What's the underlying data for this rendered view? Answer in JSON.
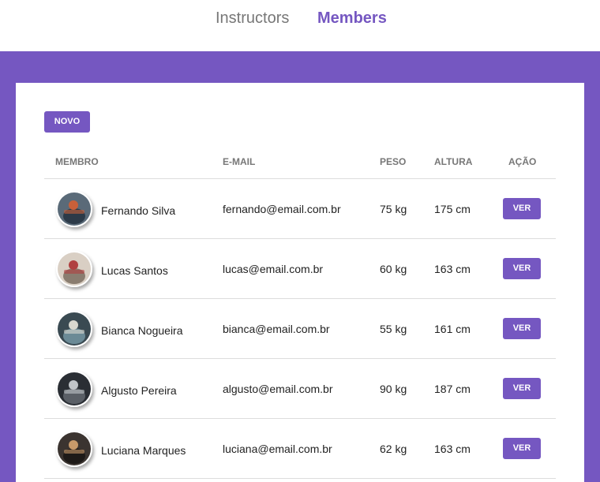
{
  "nav": {
    "items": [
      {
        "label": "Instructors"
      },
      {
        "label": "Members"
      }
    ]
  },
  "new_button": "NOVO",
  "table": {
    "headers": {
      "member": "MEMBRO",
      "email": "E-MAIL",
      "weight": "PESO",
      "height": "ALTURA",
      "action": "AÇÃO"
    },
    "action_label": "VER",
    "rows": [
      {
        "name": "Fernando Silva",
        "email": "fernando@email.com.br",
        "weight": "75 kg",
        "height": "175 cm",
        "avatar_colors": [
          "#5a6a78",
          "#c8603a",
          "#2c3a48"
        ]
      },
      {
        "name": "Lucas Santos",
        "email": "lucas@email.com.br",
        "weight": "60 kg",
        "height": "163 cm",
        "avatar_colors": [
          "#d9cfc4",
          "#b04040",
          "#8a7d70"
        ]
      },
      {
        "name": "Bianca Nogueira",
        "email": "bianca@email.com.br",
        "weight": "55 kg",
        "height": "161 cm",
        "avatar_colors": [
          "#3a4a52",
          "#d8d8d0",
          "#6b8a96"
        ]
      },
      {
        "name": "Algusto Pereira",
        "email": "algusto@email.com.br",
        "weight": "90 kg",
        "height": "187 cm",
        "avatar_colors": [
          "#2a2e34",
          "#c0c4c8",
          "#5a5f66"
        ]
      },
      {
        "name": "Luciana Marques",
        "email": "luciana@email.com.br",
        "weight": "62 kg",
        "height": "163 cm",
        "avatar_colors": [
          "#3b3430",
          "#c89a6a",
          "#1e1a18"
        ]
      }
    ]
  },
  "colors": {
    "accent": "#7557c1",
    "header_text": "#777777",
    "divider": "#dddddd"
  }
}
